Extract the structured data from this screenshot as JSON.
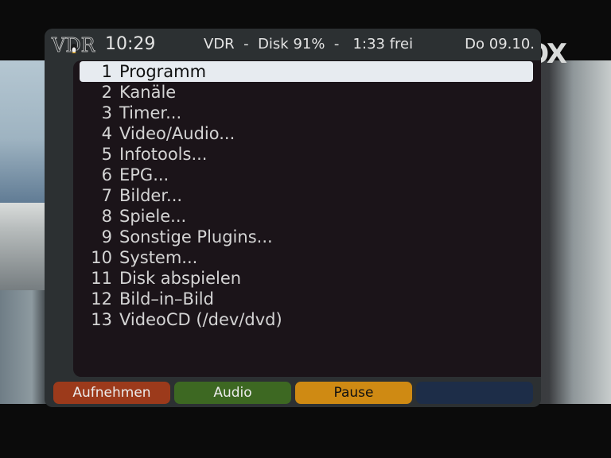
{
  "header": {
    "logo": "VDR",
    "clock": "10:29",
    "title": "VDR  -  Disk 91%  -   1:33 frei",
    "date": "Do 09.10."
  },
  "menu": {
    "selected_index": 0,
    "items": [
      {
        "num": "1",
        "label": "Programm"
      },
      {
        "num": "2",
        "label": "Kanäle"
      },
      {
        "num": "3",
        "label": "Timer..."
      },
      {
        "num": "4",
        "label": "Video/Audio..."
      },
      {
        "num": "5",
        "label": "Infotools..."
      },
      {
        "num": "6",
        "label": "EPG..."
      },
      {
        "num": "7",
        "label": "Bilder..."
      },
      {
        "num": "8",
        "label": "Spiele..."
      },
      {
        "num": "9",
        "label": "Sonstige Plugins..."
      },
      {
        "num": "10",
        "label": "System..."
      },
      {
        "num": "11",
        "label": "Disk abspielen"
      },
      {
        "num": "12",
        "label": "Bild–in–Bild"
      },
      {
        "num": "13",
        "label": "VideoCD (/dev/dvd)"
      }
    ]
  },
  "buttons": {
    "red": "Aufnehmen",
    "green": "Audio",
    "yellow": "Pause",
    "blue": ""
  },
  "channel_logo": "FOX",
  "colors": {
    "red": "#9c3a1b",
    "green": "#3d6822",
    "yellow": "#cf8a13",
    "blue": "#1d2d48",
    "selection": "#e7ebf0"
  }
}
